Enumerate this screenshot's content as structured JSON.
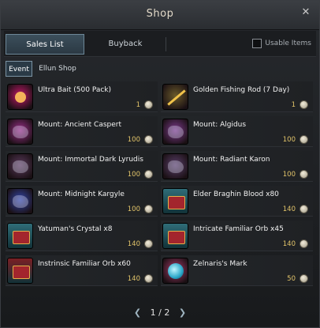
{
  "window": {
    "title": "Shop",
    "close_symbol": "✕"
  },
  "tabs": [
    {
      "label": "Sales List",
      "active": true
    },
    {
      "label": "Buyback",
      "active": false
    }
  ],
  "usable_items_label": "Usable Items",
  "subtabs": [
    {
      "label": "Event",
      "active": true
    },
    {
      "label": "Ellun Shop",
      "active": false
    }
  ],
  "items": [
    {
      "name": "Ultra Bait (500 Pack)",
      "price": "1",
      "icon": "bait-icon",
      "color": "#c2186a"
    },
    {
      "name": "Golden Fishing Rod (7 Day)",
      "price": "1",
      "icon": "fishing-rod-icon",
      "color": "#6a5a2a"
    },
    {
      "name": "Mount: Ancient Caspert",
      "price": "100",
      "icon": "mount-icon",
      "color": "#9b2f8a"
    },
    {
      "name": "Mount: Algidus",
      "price": "100",
      "icon": "mount-icon",
      "color": "#7d3a8d"
    },
    {
      "name": "Mount: Immortal Dark Lyrudis",
      "price": "100",
      "icon": "mount-icon",
      "color": "#5a3a5c"
    },
    {
      "name": "Mount: Radiant Karon",
      "price": "100",
      "icon": "mount-icon",
      "color": "#5a3f6a"
    },
    {
      "name": "Mount: Midnight Kargyle",
      "price": "100",
      "icon": "mount-icon",
      "color": "#3346a8"
    },
    {
      "name": "Elder Braghin Blood x80",
      "price": "140",
      "icon": "chest-icon",
      "color": "#2f6d78"
    },
    {
      "name": "Yatuman's Crystal x8",
      "price": "140",
      "icon": "chest-icon",
      "color": "#2f6d78"
    },
    {
      "name": "Intricate Familiar Orb x45",
      "price": "140",
      "icon": "chest-icon",
      "color": "#2f6d78"
    },
    {
      "name": "Instrinsic Familiar Orb x60",
      "price": "140",
      "icon": "chest-icon",
      "color": "#7a1f24"
    },
    {
      "name": "Zelnaris's Mark",
      "price": "50",
      "icon": "orb-icon",
      "color": "#a83a6a"
    }
  ],
  "pagination": {
    "current": "1",
    "separator": "/",
    "total": "2",
    "prev": "❮",
    "next": "❯"
  }
}
